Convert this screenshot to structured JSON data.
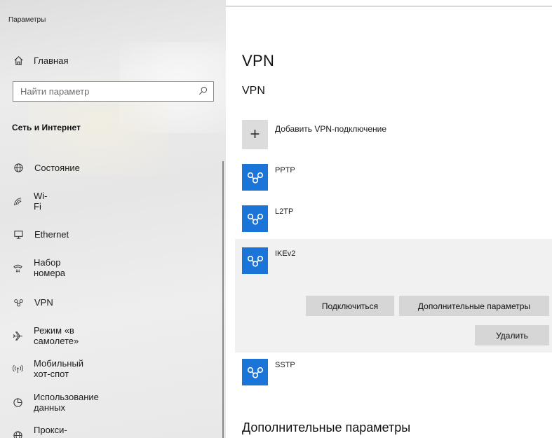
{
  "window": {
    "title": "Параметры"
  },
  "sidebar": {
    "home_label": "Главная",
    "search_placeholder": "Найти параметр",
    "section_heading": "Сеть и Интернет",
    "items": [
      {
        "label": "Состояние",
        "icon": "globe-icon"
      },
      {
        "label": "Wi-Fi",
        "icon": "wifi-icon"
      },
      {
        "label": "Ethernet",
        "icon": "ethernet-icon"
      },
      {
        "label": "Набор номера",
        "icon": "dialup-icon"
      },
      {
        "label": "VPN",
        "icon": "vpn-icon"
      },
      {
        "label": "Режим «в самолете»",
        "icon": "airplane-icon"
      },
      {
        "label": "Мобильный хот-спот",
        "icon": "hotspot-icon"
      },
      {
        "label": "Использование данных",
        "icon": "data-usage-icon"
      },
      {
        "label": "Прокси-сервер",
        "icon": "proxy-icon"
      }
    ]
  },
  "main": {
    "page_title": "VPN",
    "section_title": "VPN",
    "add_label": "Добавить VPN-подключение",
    "connections": [
      {
        "name": "PPTP",
        "selected": false
      },
      {
        "name": "L2TP",
        "selected": false
      },
      {
        "name": "IKEv2",
        "selected": true
      },
      {
        "name": "SSTP",
        "selected": false
      }
    ],
    "buttons": {
      "connect": "Подключиться",
      "advanced": "Дополнительные параметры",
      "delete": "Удалить"
    },
    "bottom_heading": "Дополнительные параметры"
  },
  "colors": {
    "accent": "#1b74d8",
    "button_bg": "#d6d6d6",
    "selected_bg": "#f1f1f1"
  }
}
